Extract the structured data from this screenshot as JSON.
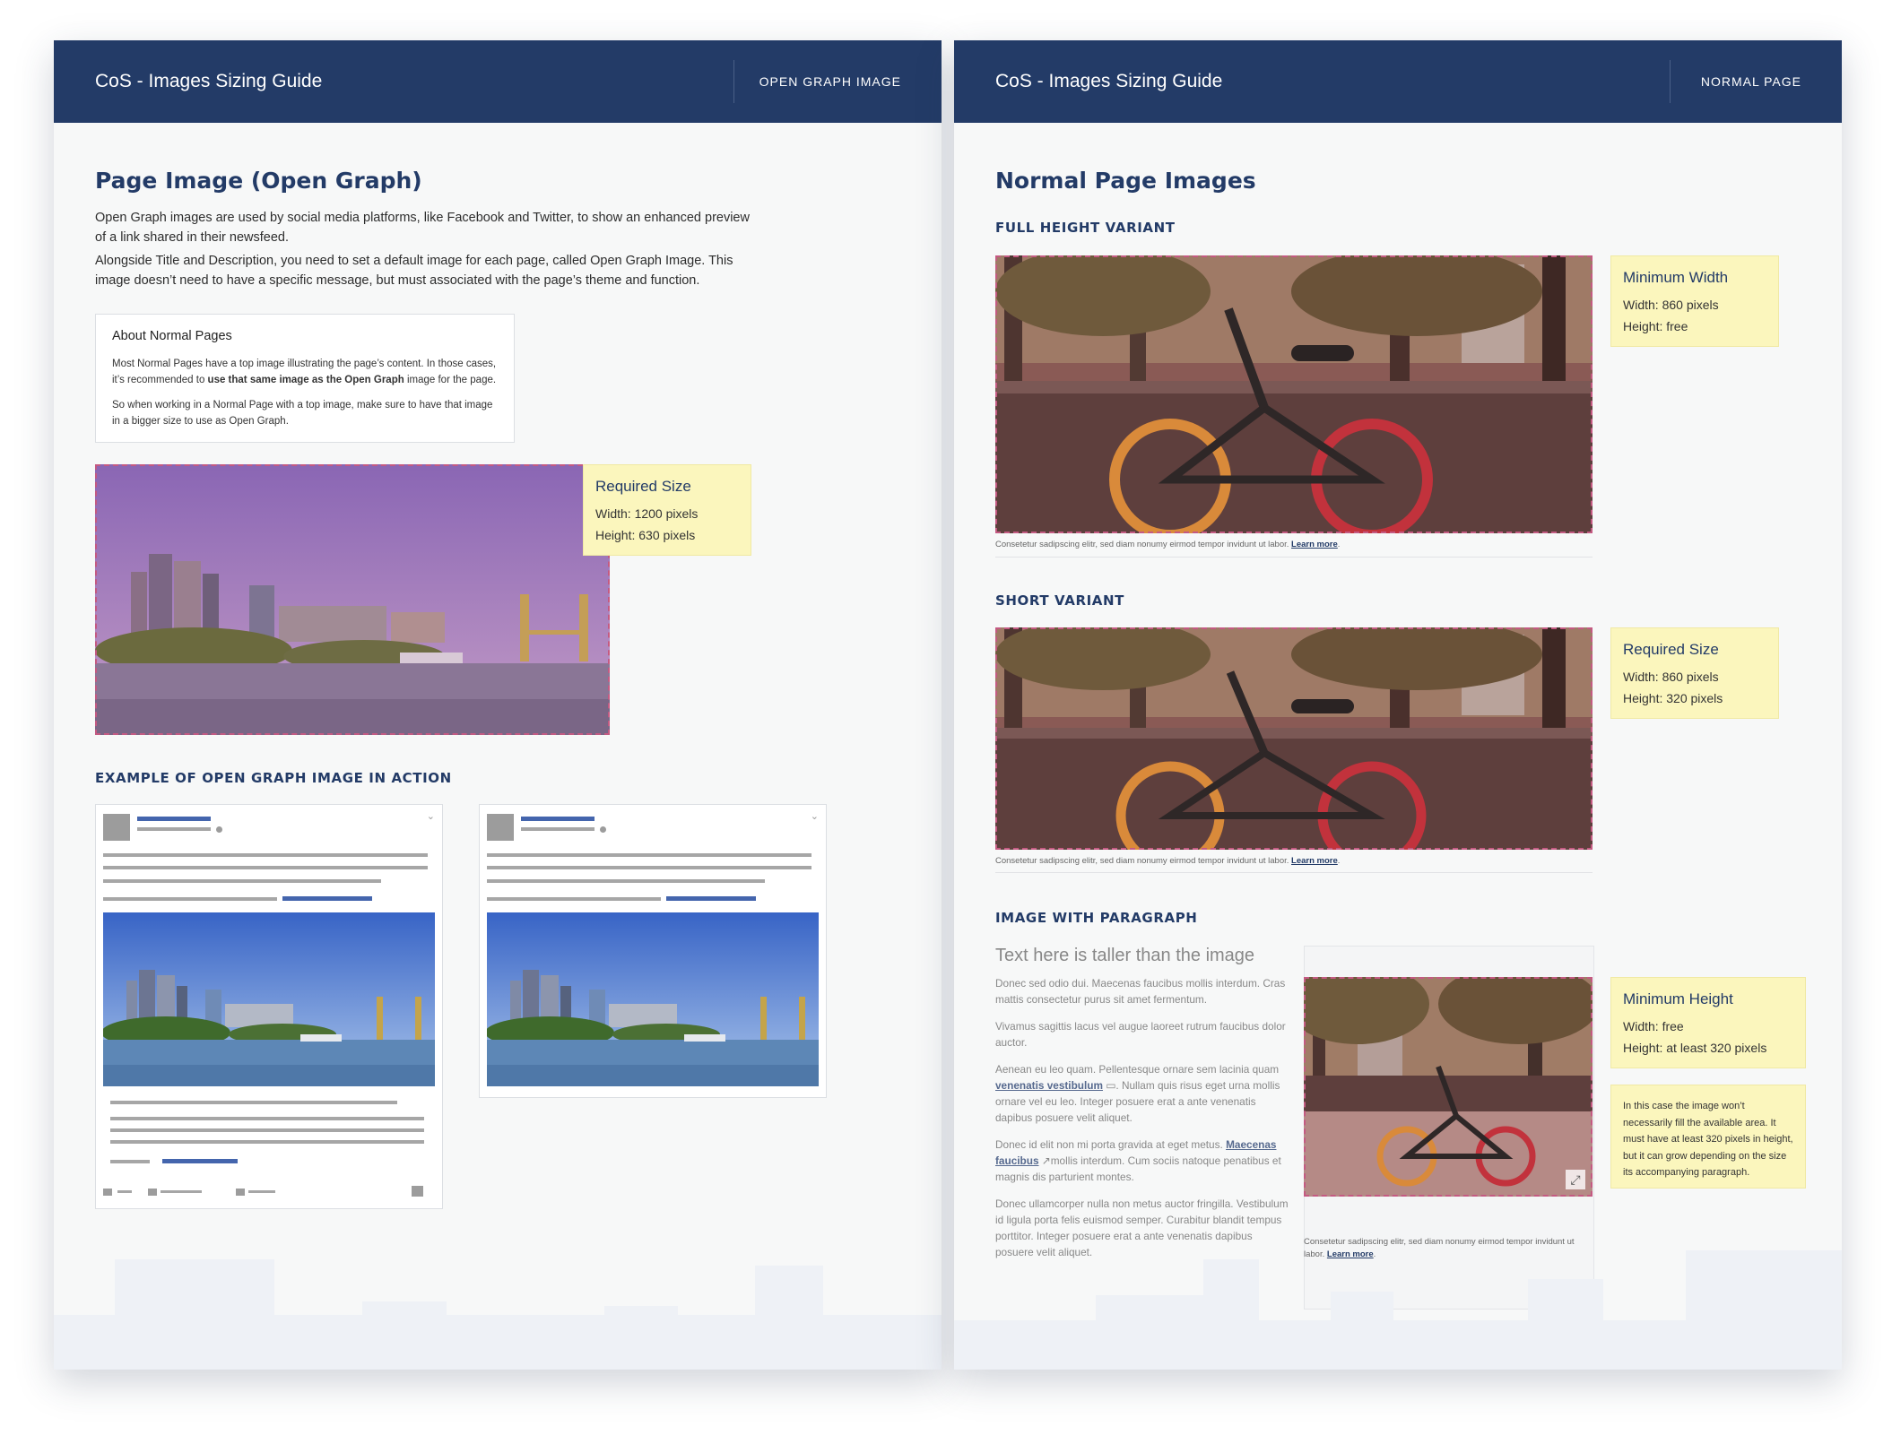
{
  "left": {
    "header": {
      "title": "CoS - Images Sizing Guide",
      "section_label": "OPEN GRAPH IMAGE"
    },
    "title": "Page Image (Open Graph)",
    "intro_1": "Open Graph images are used by social media platforms, like Facebook and Twitter, to show an enhanced preview of a link shared in their newsfeed.",
    "intro_2": "Alongside Title and Description, you need to set a default image for each page, called Open Graph Image. This image doesn’t need to have a specific message, but must associated with the page’s theme and function.",
    "about": {
      "title": "About Normal Pages",
      "p1_before": "Most Normal Pages have a top image illustrating the page’s content. In those cases, it’s recommended to ",
      "p1_bold": "use that same image as the Open Graph",
      "p1_after": " image for the page.",
      "p2": "So when working in a Normal Page with a top image, make sure to have that image in a bigger size to use as Open Graph."
    },
    "required_size": {
      "title": "Required Size",
      "width": "Width: 1200 pixels",
      "height": "Height: 630 pixels"
    },
    "example_heading": "EXAMPLE OF OPEN GRAPH IMAGE IN ACTION",
    "icons": {
      "chevron": "chevron-down-icon",
      "image": "river-city-image"
    }
  },
  "right": {
    "header": {
      "title": "CoS - Images Sizing Guide",
      "section_label": "NORMAL PAGE"
    },
    "title": "Normal Page Images",
    "full_height_heading": "FULL HEIGHT VARIANT",
    "min_width": {
      "title": "Minimum Width",
      "width": "Width: 860 pixels",
      "height": "Height: free"
    },
    "caption_text": "Consetetur sadipscing elitr, sed diam nonumy eirmod tempor invidunt ut labor.",
    "learn_more": "Learn more",
    "caption_end": ".",
    "short_heading": "SHORT VARIANT",
    "required_size": {
      "title": "Required Size",
      "width": "Width: 860 pixels",
      "height": "Height: 320 pixels"
    },
    "paragraph_heading": "IMAGE WITH PARAGRAPH",
    "taller_title": "Text here is taller than the image",
    "p1": "Donec sed odio dui. Maecenas faucibus mollis interdum. Cras mattis consectetur purus sit amet fermentum.",
    "p2": "Vivamus sagittis lacus vel augue laoreet rutrum faucibus dolor auctor.",
    "p3_before": "Aenean eu leo quam. Pellentesque ornare sem lacinia quam ",
    "p3_link": "venenatis vestibulum",
    "p3_after": ". Nullam quis risus eget urna mollis ornare vel eu leo. Integer posuere erat a ante venenatis dapibus posuere velit aliquet.",
    "p4_before": "Donec id elit non mi porta gravida at eget metus. ",
    "p4_link": "Maecenas faucibus",
    "p4_after": "mollis interdum. Cum sociis natoque penatibus et magnis dis parturient montes.",
    "p5": "Donec ullamcorper nulla non metus auctor fringilla. Vestibulum id ligula porta felis euismod semper. Curabitur blandit tempus porttitor. Integer posuere erat a ante venenatis dapibus posuere velit aliquet.",
    "min_height": {
      "title": "Minimum Height",
      "width": "Width: free",
      "height": "Height: at least 320 pixels"
    },
    "min_height_note": "In this case the image won’t necessarily fill the available area. It must have at least 320 pixels in height, but it can grow depending on the size its accompanying paragraph.",
    "icons": {
      "window": "window-icon",
      "external": "external-link-icon",
      "expand": "expand-icon",
      "image": "bicycle-image"
    }
  },
  "colors": {
    "header": "#233b67",
    "note": "#fbf6bd",
    "accent": "#4465ad",
    "dashed": "#c45a82"
  }
}
